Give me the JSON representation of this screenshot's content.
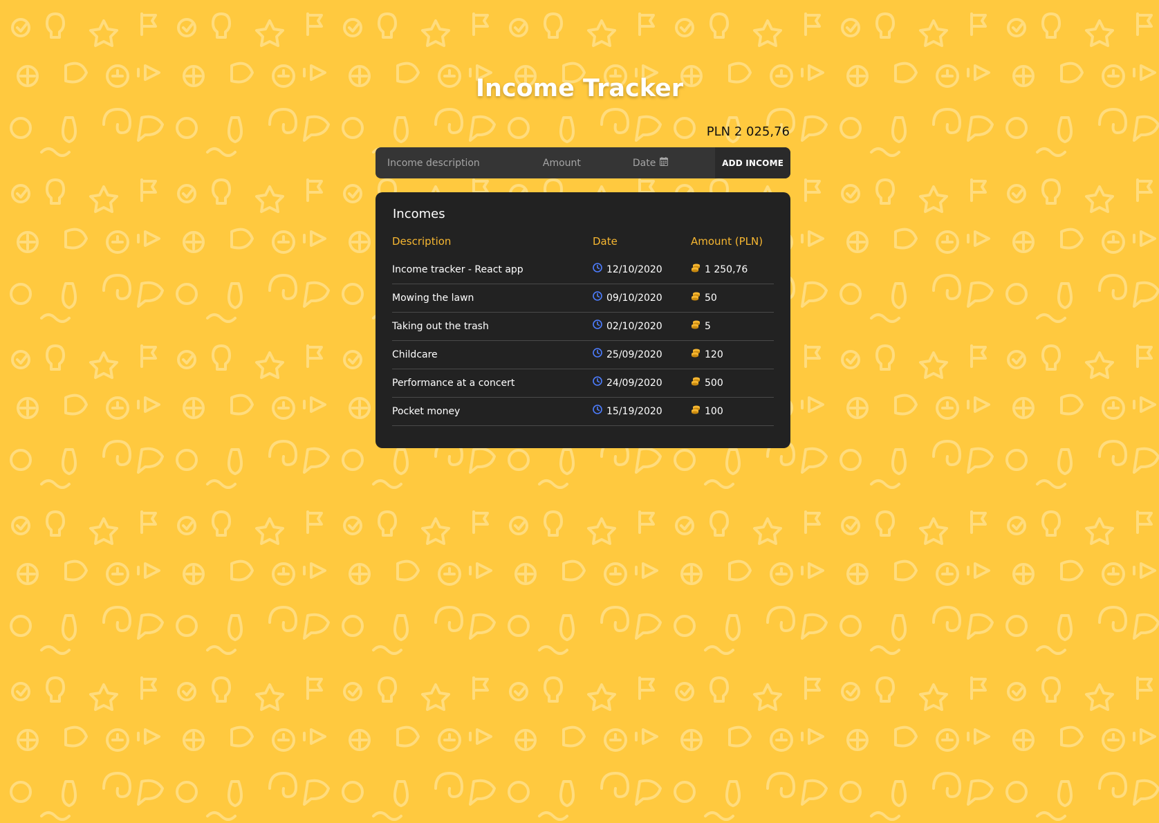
{
  "app": {
    "title": "Income Tracker",
    "balance": "PLN 2 025,76"
  },
  "form": {
    "description_placeholder": "Income description",
    "amount_placeholder": "Amount",
    "date_placeholder": "Date",
    "add_button_label": "ADD INCOME"
  },
  "incomes": {
    "heading": "Incomes",
    "columns": {
      "description": "Description",
      "date": "Date",
      "amount": "Amount (PLN)"
    },
    "rows": [
      {
        "description": "Income tracker - React app",
        "date": "12/10/2020",
        "amount": "1 250,76"
      },
      {
        "description": "Mowing the lawn",
        "date": "09/10/2020",
        "amount": "50"
      },
      {
        "description": "Taking out the trash",
        "date": "02/10/2020",
        "amount": "5"
      },
      {
        "description": "Childcare",
        "date": "25/09/2020",
        "amount": "120"
      },
      {
        "description": "Performance at a concert",
        "date": "24/09/2020",
        "amount": "500"
      },
      {
        "description": "Pocket money",
        "date": "15/19/2020",
        "amount": "100"
      }
    ]
  },
  "theme": {
    "background": "#ffc93f",
    "panel": "#222222",
    "accent": "#f7b731",
    "clock_icon_color": "#4d7dff",
    "coins_icon_color": "#f7b731"
  },
  "icons": {
    "date_field": "calendar-icon",
    "row_date": "clock-icon",
    "row_amount": "coins-icon"
  }
}
